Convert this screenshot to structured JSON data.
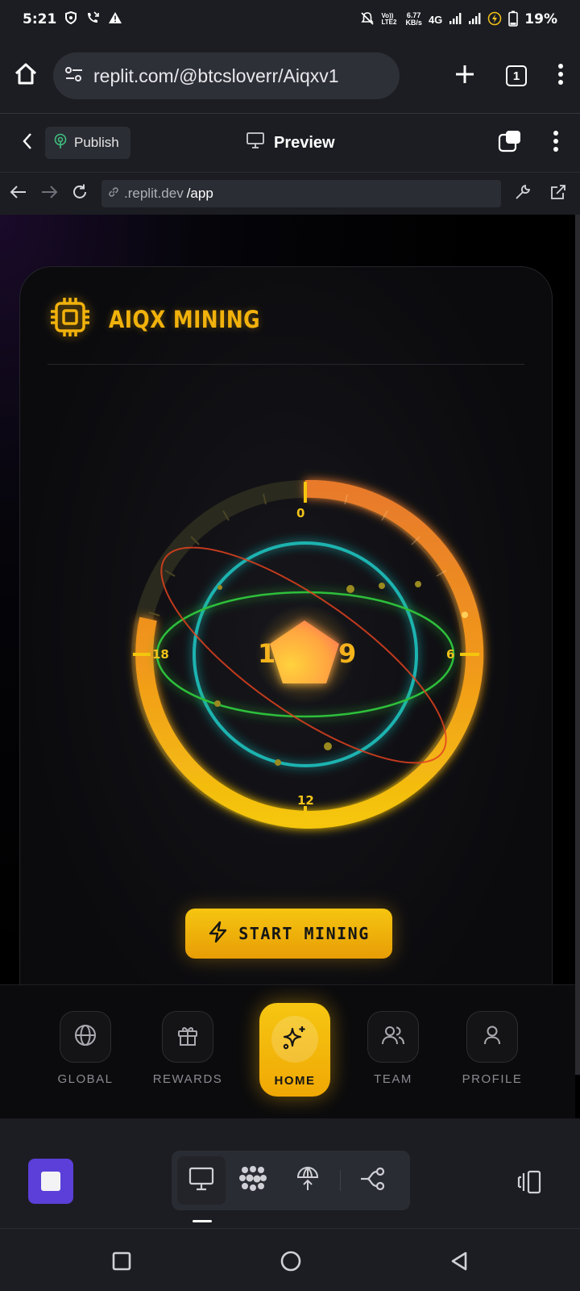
{
  "status_bar": {
    "time": "5:21",
    "network_label": "4G",
    "speed_value": "6.77",
    "speed_unit": "KB/s",
    "volte_label": "Vo)) LTE2",
    "battery_percent": "19%"
  },
  "browser": {
    "url": "replit.com/@btcsloverr/Aiqxv1",
    "tab_count": "1"
  },
  "replit_header": {
    "publish_label": "Publish",
    "preview_label": "Preview"
  },
  "dev_bar": {
    "url_domain": ".replit.dev",
    "url_path": "/app"
  },
  "app": {
    "title": "AIQX MINING",
    "orbit_labels": {
      "top": "0",
      "right": "6",
      "bottom": "12",
      "left": "18"
    },
    "start_button_label": "START MINING",
    "nav": [
      {
        "label": "GLOBAL",
        "icon": "globe-icon"
      },
      {
        "label": "REWARDS",
        "icon": "gift-icon"
      },
      {
        "label": "HOME",
        "icon": "sparkles-icon"
      },
      {
        "label": "TEAM",
        "icon": "users-icon"
      },
      {
        "label": "PROFILE",
        "icon": "user-icon"
      }
    ],
    "active_nav": "HOME"
  },
  "colors": {
    "accent_gold": "#f2b20c",
    "ring_orange": "#e8762a",
    "ring_cyan": "#1fb3b0",
    "ring_green": "#2fbf3a",
    "replit_purple": "#5b3fd8",
    "chrome_bg": "#1c1d22"
  }
}
